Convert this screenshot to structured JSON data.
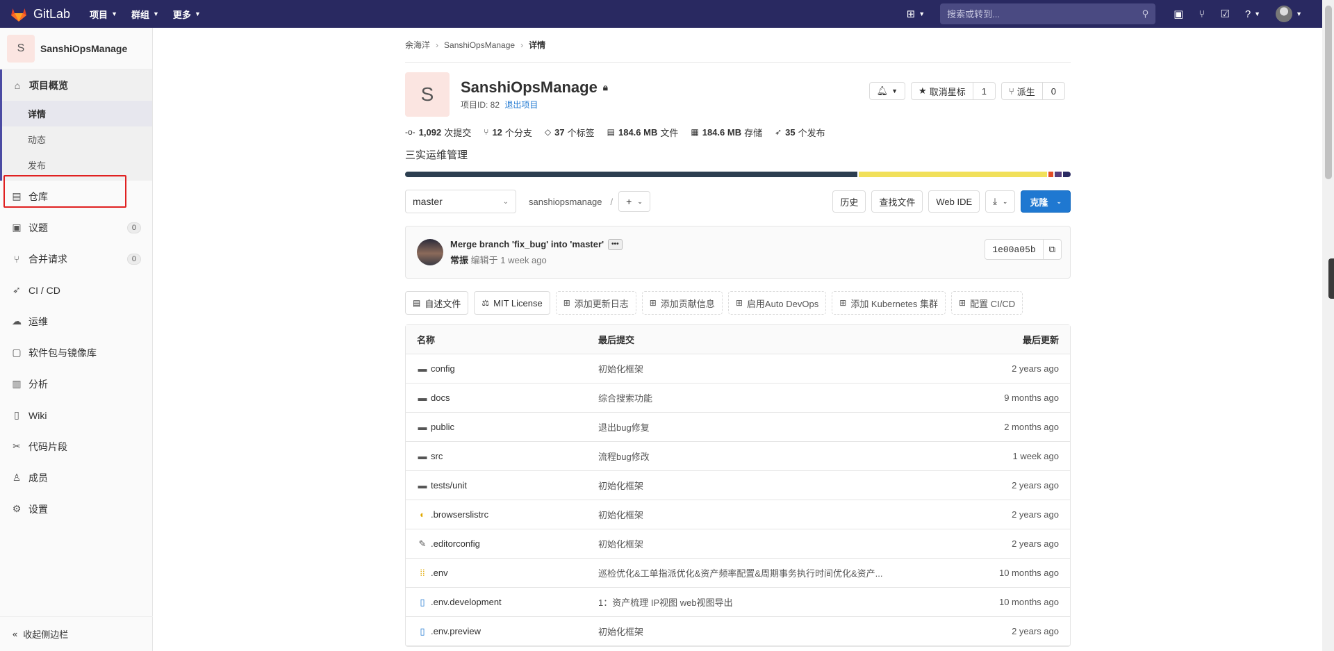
{
  "topbar": {
    "logo_text": "GitLab",
    "menu": [
      {
        "label": "项目"
      },
      {
        "label": "群组"
      },
      {
        "label": "更多"
      }
    ],
    "search_placeholder": "搜索或转到..."
  },
  "sidebar": {
    "project_initial": "S",
    "project_name": "SanshiOpsManage",
    "overview_label": "项目概览",
    "overview_sub": [
      "详情",
      "动态",
      "发布"
    ],
    "items": [
      {
        "label": "仓库",
        "icon": "file-icon"
      },
      {
        "label": "议题",
        "icon": "issues-icon",
        "badge": "0"
      },
      {
        "label": "合并请求",
        "icon": "merge-request-icon",
        "badge": "0"
      },
      {
        "label": "CI / CD",
        "icon": "rocket-icon"
      },
      {
        "label": "运维",
        "icon": "cloud-icon"
      },
      {
        "label": "软件包与镜像库",
        "icon": "package-icon"
      },
      {
        "label": "分析",
        "icon": "chart-icon"
      },
      {
        "label": "Wiki",
        "icon": "book-icon"
      },
      {
        "label": "代码片段",
        "icon": "scissors-icon"
      },
      {
        "label": "成员",
        "icon": "users-icon"
      },
      {
        "label": "设置",
        "icon": "gear-icon"
      }
    ],
    "collapse_label": "收起侧边栏"
  },
  "breadcrumb": [
    "余海洋",
    "SanshiOpsManage",
    "详情"
  ],
  "project": {
    "initial": "S",
    "title": "SanshiOpsManage",
    "id_label": "项目ID: 82",
    "leave_label": "退出项目",
    "unstar_label": "取消星标",
    "star_count": "1",
    "fork_label": "派生",
    "fork_count": "0",
    "description": "三实运维管理"
  },
  "stats": [
    {
      "icon": "commit-icon",
      "value": "1,092",
      "label": "次提交"
    },
    {
      "icon": "branch-icon",
      "value": "12",
      "label": "个分支"
    },
    {
      "icon": "tag-icon",
      "value": "37",
      "label": "个标签"
    },
    {
      "icon": "file-icon",
      "value": "184.6 MB",
      "label": "文件"
    },
    {
      "icon": "storage-icon",
      "value": "184.6 MB",
      "label": "存储"
    },
    {
      "icon": "rocket-icon",
      "value": "35",
      "label": "个发布"
    }
  ],
  "language_bar": [
    {
      "color": "#2c3e50",
      "percent": 68.5
    },
    {
      "color": "#f1e05a",
      "percent": 28.5
    },
    {
      "color": "#e34c26",
      "percent": 0.8
    },
    {
      "color": "#563d7c",
      "percent": 1.0
    },
    {
      "color": "#292961",
      "percent": 1.2
    }
  ],
  "controls": {
    "branch": "master",
    "path": "sanshiopsmanage",
    "history": "历史",
    "find_file": "查找文件",
    "web_ide": "Web IDE",
    "clone": "克隆"
  },
  "commit": {
    "title": "Merge branch 'fix_bug' into 'master'",
    "author": "常振",
    "meta": "编辑于 1 week ago",
    "sha": "1e00a05b"
  },
  "quicklinks": [
    {
      "label": "自述文件",
      "dashed": false,
      "icon": "doc-icon"
    },
    {
      "label": "MIT License",
      "dashed": false,
      "icon": "scale-icon"
    },
    {
      "label": "添加更新日志",
      "dashed": true,
      "icon": "plus-square-icon"
    },
    {
      "label": "添加贡献信息",
      "dashed": true,
      "icon": "plus-square-icon"
    },
    {
      "label": "启用Auto DevOps",
      "dashed": true,
      "icon": "plus-square-icon"
    },
    {
      "label": "添加 Kubernetes 集群",
      "dashed": true,
      "icon": "plus-square-icon"
    },
    {
      "label": "配置 CI/CD",
      "dashed": true,
      "icon": "plus-square-icon"
    }
  ],
  "tree": {
    "headers": {
      "name": "名称",
      "commit": "最后提交",
      "date": "最后更新"
    },
    "rows": [
      {
        "name": "config",
        "type": "folder",
        "commit": "初始化框架",
        "date": "2 years ago"
      },
      {
        "name": "docs",
        "type": "folder",
        "commit": "综合搜索功能",
        "date": "9 months ago"
      },
      {
        "name": "public",
        "type": "folder",
        "commit": "退出bug修复",
        "date": "2 months ago"
      },
      {
        "name": "src",
        "type": "folder",
        "commit": "流程bug修改",
        "date": "1 week ago"
      },
      {
        "name": "tests/unit",
        "type": "folder",
        "commit": "初始化框架",
        "date": "2 years ago"
      },
      {
        "name": ".browserslistrc",
        "type": "browserslist",
        "commit": "初始化框架",
        "date": "2 years ago"
      },
      {
        "name": ".editorconfig",
        "type": "editorconfig",
        "commit": "初始化框架",
        "date": "2 years ago"
      },
      {
        "name": ".env",
        "type": "env",
        "commit": "巡检优化&工单指派优化&资产频率配置&周期事务执行时间优化&资产...",
        "date": "10 months ago"
      },
      {
        "name": ".env.development",
        "type": "file",
        "commit": "1：资产梳理 IP视图 web视图导出",
        "date": "10 months ago"
      },
      {
        "name": ".env.preview",
        "type": "file",
        "commit": "初始化框架",
        "date": "2 years ago"
      }
    ]
  }
}
